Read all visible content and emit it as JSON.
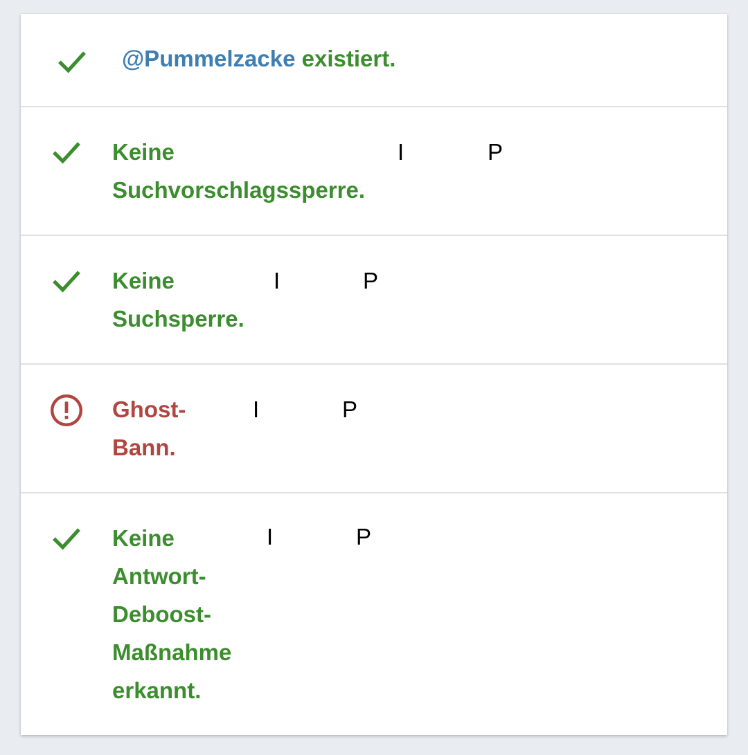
{
  "colors": {
    "success": "#3b8d2e",
    "error": "#b0463f",
    "username": "#3d7eb3"
  },
  "rows": [
    {
      "status": "success",
      "icon": "check-icon",
      "username": "@Pummelzacke",
      "text": "existiert."
    },
    {
      "status": "success",
      "icon": "check-icon",
      "lines": [
        "Keine",
        "Suchvorschlagssperre."
      ],
      "markers": [
        "I",
        "P"
      ]
    },
    {
      "status": "success",
      "icon": "check-icon",
      "lines": [
        "Keine",
        "Suchsperre."
      ],
      "markers": [
        "I",
        "P"
      ]
    },
    {
      "status": "error",
      "icon": "alert-circle-icon",
      "lines": [
        "Ghost-",
        "Bann."
      ],
      "markers": [
        "I",
        "P"
      ]
    },
    {
      "status": "success",
      "icon": "check-icon",
      "lines": [
        "Keine",
        "Antwort-",
        "Deboost-",
        "Maßnahme",
        "erkannt."
      ],
      "markers": [
        "I",
        "P"
      ]
    }
  ]
}
